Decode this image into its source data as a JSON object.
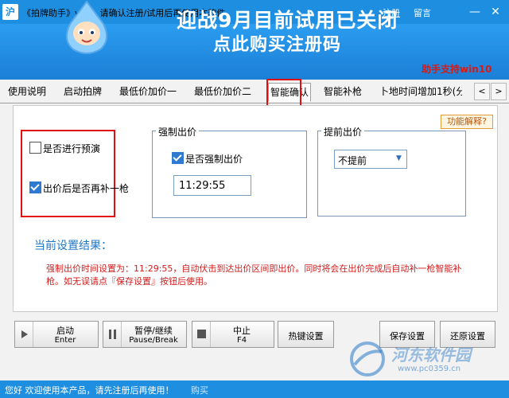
{
  "titlebar": {
    "logo": "沪",
    "title": "《拍牌助手》v12，请确认注册/试用后再使用本软件",
    "register": "注册",
    "message": "留言",
    "minimize": "—",
    "close": "✕"
  },
  "banner": {
    "line1": "迎战9月目前试用已关闭",
    "line2": "点此购买注册码",
    "support": "助手支持win10"
  },
  "tabs": [
    {
      "label": "使用说明"
    },
    {
      "label": "启动拍牌"
    },
    {
      "label": "最低价加价一"
    },
    {
      "label": "最低价加价二"
    },
    {
      "label": "智能确认"
    },
    {
      "label": "智能补枪"
    },
    {
      "label": "卜地时间增加1秒(分"
    }
  ],
  "tab_arrows": {
    "prev": "<",
    "next": ">"
  },
  "options": {
    "rehearsal": {
      "label": "是否进行预演",
      "checked": false
    },
    "refire": {
      "label": "出价后是否再补一枪",
      "checked": true
    }
  },
  "force_bid": {
    "title": "强制出价",
    "checkbox_label": "是否强制出价",
    "checked": true,
    "time": "11:29:55"
  },
  "advance_bid": {
    "title": "提前出价",
    "selected": "不提前"
  },
  "function_explain": "功能解释?",
  "result": {
    "title": "当前设置结果：",
    "text": "强制出价时间设置为：11:29:55，自动伏击到达出价区间即出价。同时将会在出价完成后自动补一枪智能补枪。如无误请点『保存设置』按钮后使用。"
  },
  "buttons": {
    "start": {
      "line1": "启动",
      "line2": "Enter"
    },
    "pause": {
      "line1": "暂停/继续",
      "line2": "Pause/Break"
    },
    "stop": {
      "line1": "中止",
      "line2": "F4"
    },
    "hotkey": "热键设置",
    "save": "保存设置",
    "restore": "还原设置"
  },
  "statusbar": {
    "text": "您好 欢迎使用本产品，请先注册后再使用！",
    "buy": "购买"
  },
  "watermark": {
    "text": "河东软件园",
    "url": "www.pc0359.cn"
  },
  "colors": {
    "accent": "#1e8fe0",
    "highlight": "#e01010",
    "result_text": "#d21c1c"
  }
}
